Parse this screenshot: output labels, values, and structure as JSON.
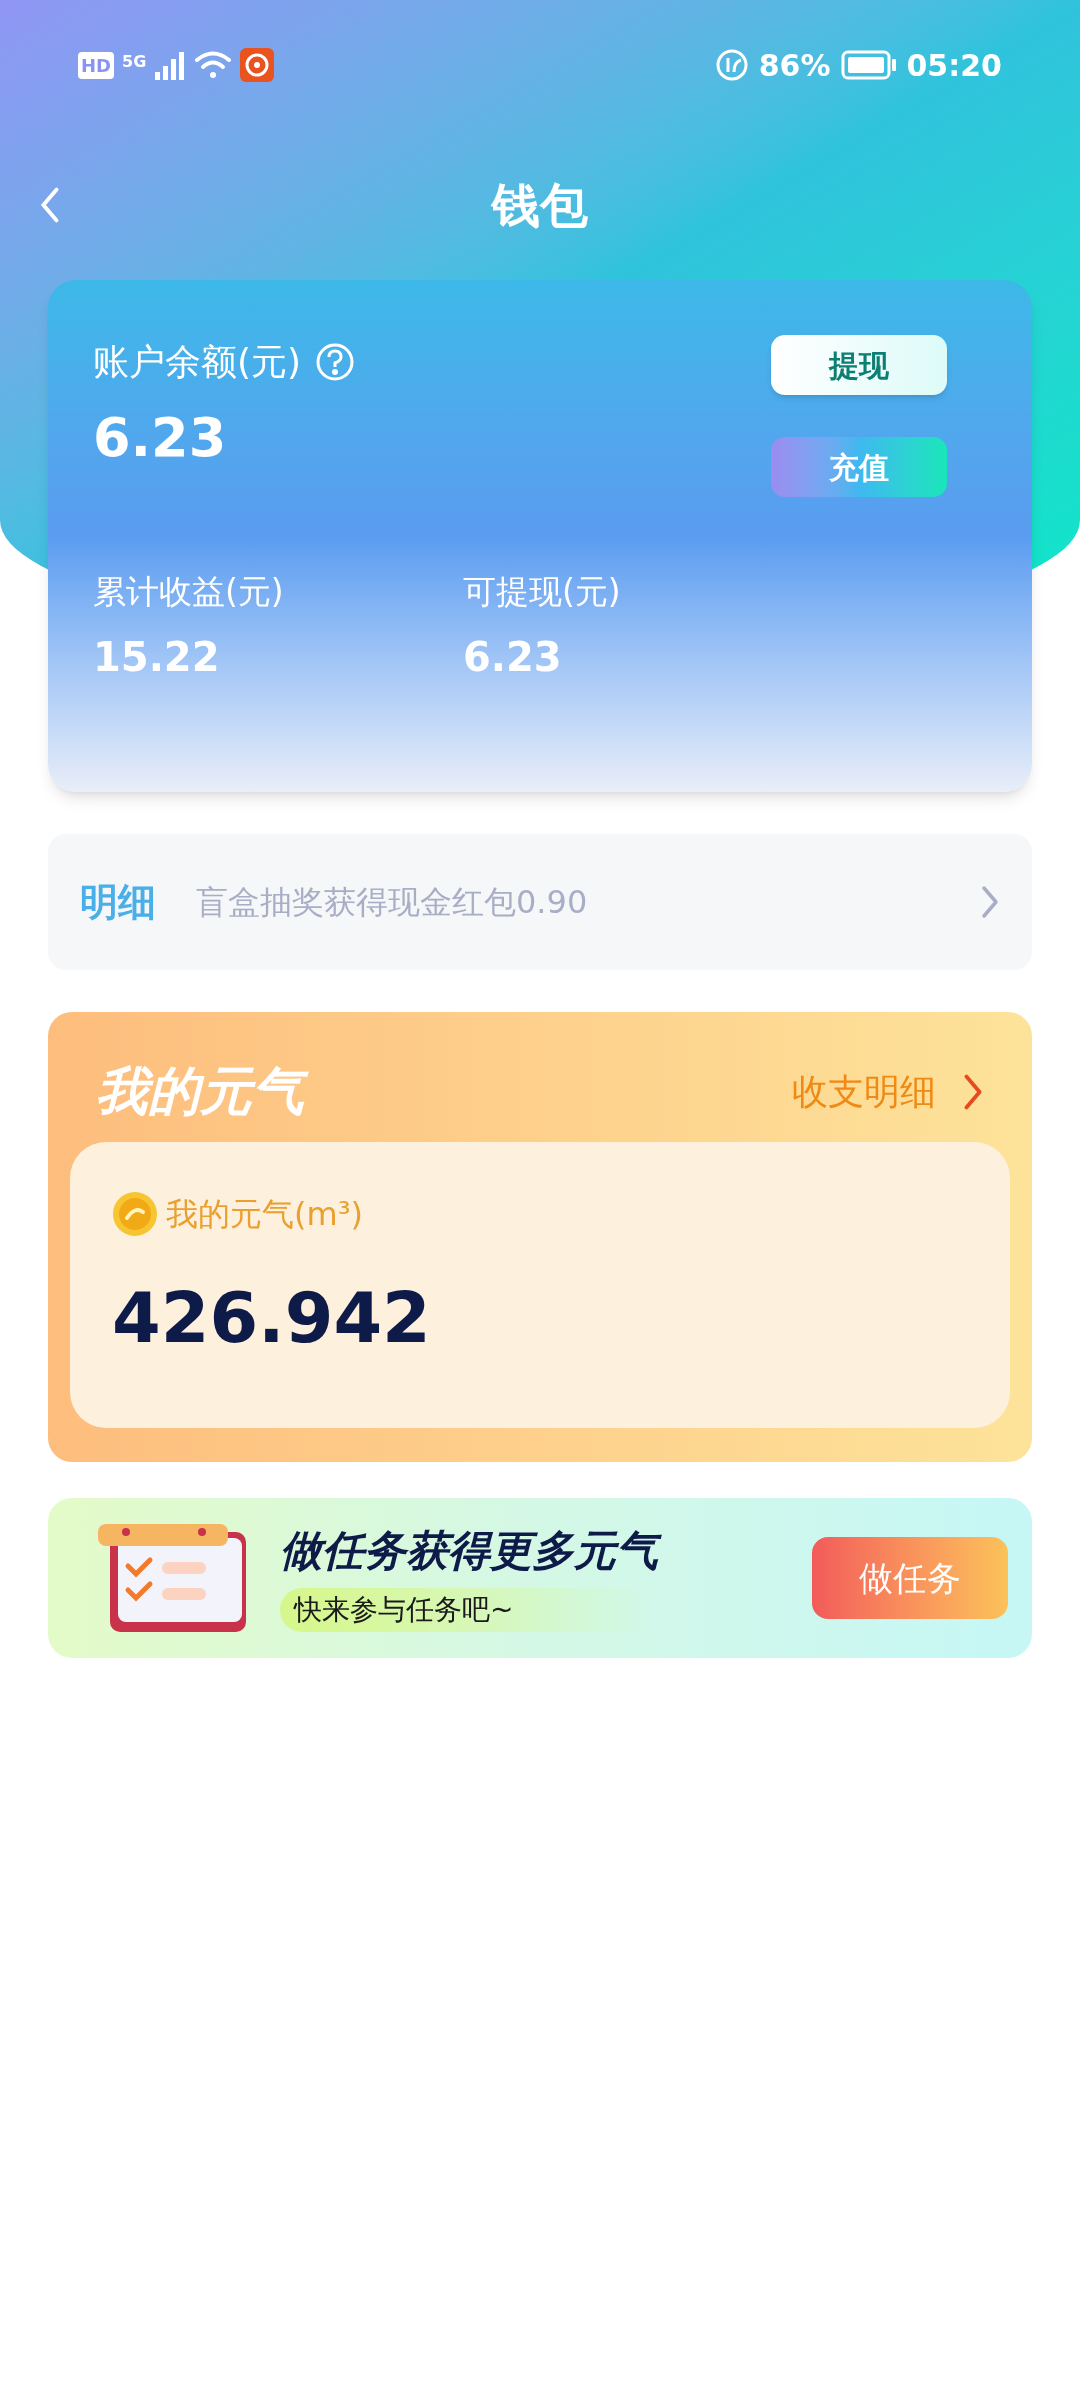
{
  "status_bar": {
    "hd": "HD",
    "network": "5G",
    "battery_percent": "86%",
    "time": "05:20"
  },
  "header": {
    "title": "钱包"
  },
  "balance_card": {
    "label": "账户余额(元)",
    "amount": "6.23",
    "buttons": [
      {
        "kind": "plain",
        "label": "提现"
      },
      {
        "kind": "gradient",
        "label": "充值"
      }
    ],
    "stats": [
      {
        "label": "累计收益(元)",
        "value": "15.22"
      },
      {
        "label": "可提现(元)",
        "value": "6.23"
      }
    ]
  },
  "detail_row": {
    "tag": "明细",
    "text": "盲盒抽奖获得现金红包0.90"
  },
  "energy_card": {
    "title": "我的元气",
    "link": "收支明细",
    "label": "我的元气(m³)",
    "value": "426.942"
  },
  "task_banner": {
    "title": "做任务获得更多元气",
    "subtitle": "快来参与任务吧~",
    "button": "做任务"
  }
}
